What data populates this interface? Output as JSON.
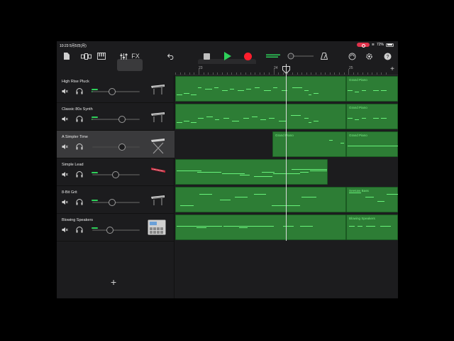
{
  "status": {
    "time": "10:23",
    "date": "5月5日(月)",
    "battery": "72%"
  },
  "toolbar": {
    "fx_label": "FX"
  },
  "ruler": {
    "bars": [
      "23",
      "24",
      "25"
    ]
  },
  "tracks": [
    {
      "name": "High Rise Pluck",
      "volume": 0.42,
      "level": 2,
      "instrument_icon": "keyboard-icon"
    },
    {
      "name": "Classic 80s Synth",
      "volume": 0.63,
      "level": 2,
      "instrument_icon": "keyboard-icon"
    },
    {
      "name": "A Simpler Time",
      "volume": 0.63,
      "level": 0,
      "instrument_icon": "keyboard-stand-icon"
    },
    {
      "name": "Simple Lead",
      "volume": 0.49,
      "level": 1,
      "instrument_icon": "red-keyboard-icon"
    },
    {
      "name": "8-Bit Grit",
      "volume": 0.42,
      "level": 1,
      "instrument_icon": "keyboard-icon"
    },
    {
      "name": "Blowing Speakers",
      "volume": 0.37,
      "level": 1,
      "instrument_icon": "drum-machine-icon"
    }
  ],
  "regions": [
    [
      {
        "title": "",
        "dark": false
      },
      {
        "title": "Grand Piano",
        "dark": false
      }
    ],
    [
      {
        "title": "",
        "dark": false
      },
      {
        "title": "Grand Piano",
        "dark": false
      }
    ],
    [
      {
        "title": "Grand Piano",
        "dark": false
      },
      {
        "title": "Grand Piano",
        "dark": false
      }
    ],
    [
      {
        "title": "",
        "dark": false
      }
    ],
    [
      {
        "title": "",
        "dark": false
      },
      {
        "title": "Seesaw Bass",
        "dark": false
      }
    ],
    [
      {
        "title": "",
        "dark": false
      },
      {
        "title": "Blowing Speakers",
        "dark": false
      }
    ]
  ],
  "add_track_label": "+",
  "add_bar_label": "+"
}
